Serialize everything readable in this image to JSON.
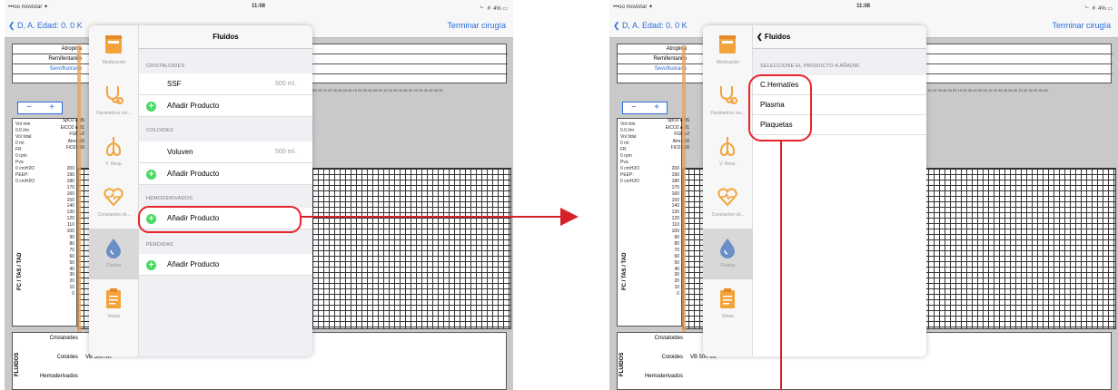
{
  "status": {
    "carrier": "•••oo movistar ✦",
    "time": "11:08",
    "battery": "ᄂ ∦ 4% ▭"
  },
  "nav": {
    "patient": "❮ D, A. Edad: 0. 0 K",
    "finish": "Terminar cirugía"
  },
  "drugs": [
    {
      "name": "Atropina"
    },
    {
      "name": "Remifentanilo"
    },
    {
      "name": "Sevofluorano"
    }
  ],
  "timeline": "35 45 55 05 15 25 35 45 55 05 15 25 35 45 55 05 15 25 35 45 55 05 15 25 35 45 55 05",
  "zoom": {
    "minus": "−",
    "plus": "+"
  },
  "side_values": "Vol min\n0.0 l/m\nVol tidal\n0 ml\nFR\n0 rpm\nPva\n0 cmH2O\nPEEP:\n0 cmH2O",
  "vitals": "SpO2 ■ 95\nEtCO2 ■ 31\nFGF ▸2\nAire ▸50\nFiO2 ▸50",
  "axis": "200\n190\n180\n170\n160\n150\n140\n130\n120\n110\n100\n90\n80\n70\n60\n50\n40\n30\n20\n10\n0",
  "yaxis_label": "FC / TAS / TAD",
  "fluid_box": {
    "cristaloides": "Cristaloides",
    "coloides": "Coloides",
    "coloides_val": "VB 500 ml.",
    "hemoderivados": "Hemoderivados",
    "side": "FLUIDOS"
  },
  "tabs": [
    {
      "label": "Medicación",
      "icon": "medication-icon"
    },
    {
      "label": "Parámetros res...",
      "icon": "stethoscope-icon"
    },
    {
      "label": "V. Resp.",
      "icon": "lungs-icon"
    },
    {
      "label": "Constantes vit...",
      "icon": "heart-rate-icon"
    },
    {
      "label": "Fluidos",
      "icon": "drop-icon"
    },
    {
      "label": "Notas",
      "icon": "clipboard-icon"
    }
  ],
  "left_popover": {
    "title": "Fluidos",
    "sections": {
      "cristaloides": "CRISTALOIDES",
      "coloides": "COLOIDES",
      "hemoderivados": "HEMODERIVADOS",
      "perdidas": "PÉRDIDAS"
    },
    "ssf": {
      "name": "SSF",
      "value": "500 ml."
    },
    "voluven": {
      "name": "Voluven",
      "value": "500 ml."
    },
    "add_label": "Añadir Producto",
    "plus": "+"
  },
  "right_popover": {
    "back": "❮ Fluidos",
    "section": "SELECCIONE EL PRODUCTO A AÑADIR",
    "products": [
      "C.Hematíes",
      "Plasma",
      "Plaquetas"
    ]
  },
  "colors": {
    "accent": "#2a6dd9",
    "highlight": "#e8232a",
    "add_green": "#4cd964",
    "active_tab": "#d8d8d8"
  }
}
